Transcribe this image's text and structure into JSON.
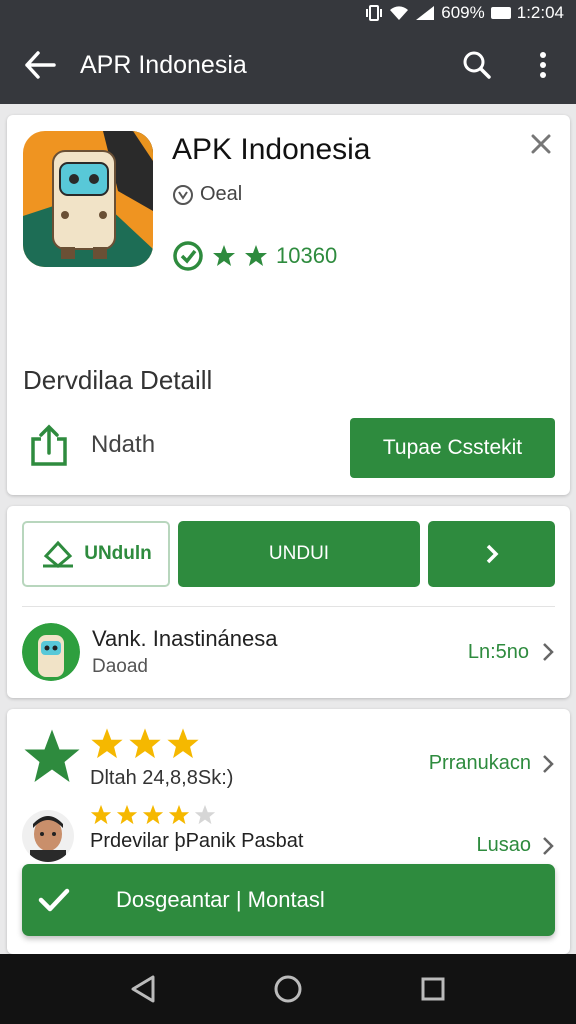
{
  "status_bar": {
    "battery": "609%",
    "time": "1:2:04"
  },
  "app_bar": {
    "title": "APR Indonesia"
  },
  "app_card": {
    "name": "APK Indonesia",
    "meta": "Oeal",
    "rating_text": "10360",
    "detail_title": "Dervdilaa Detaill",
    "share_label": "Ndath",
    "primary_button": "Tupae Csstekit"
  },
  "download_card": {
    "unduh_outline": "UNduln",
    "unduh_main": "UNDUI",
    "developer_name": "Vank. Inastinánesa",
    "developer_sub": "Daoad",
    "developer_link": "Ln:5no"
  },
  "reviews_card": {
    "count_text": "Dltah 24,8,8Sk:)",
    "rating_link": "Prranukacn",
    "review_text": "Prdevilar þPanik Pasbat",
    "review_link": "Lusao"
  },
  "toast": {
    "message": "Dosgeantar | Montasl"
  },
  "colors": {
    "accent": "#2e8b3e",
    "app_bar": "#36383d",
    "star": "#f5b800"
  }
}
